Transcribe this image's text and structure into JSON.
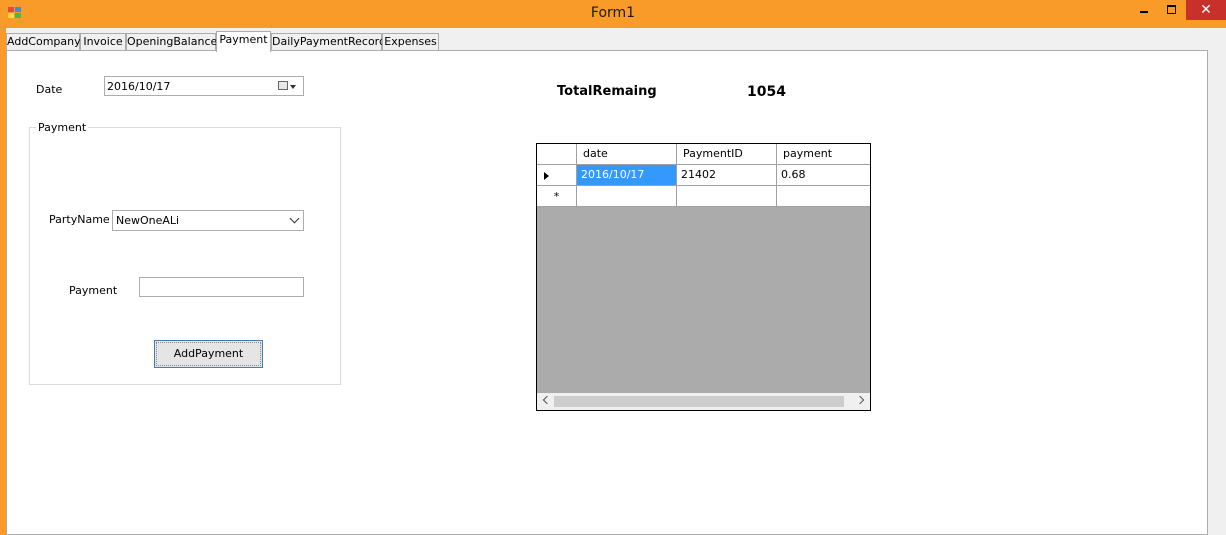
{
  "window": {
    "title": "Form1",
    "close_glyph": "✕"
  },
  "tabs": [
    {
      "label": "AddCompany"
    },
    {
      "label": "Invoice"
    },
    {
      "label": "OpeningBalance"
    },
    {
      "label": "Payment"
    },
    {
      "label": "DailyPaymentRecord"
    },
    {
      "label": "Expenses"
    }
  ],
  "active_tab": "Payment",
  "form": {
    "date_label": "Date",
    "date_value": "2016/10/17",
    "group_title": "Payment",
    "party_label": "PartyName",
    "party_value": "NewOneALi",
    "payment_label": "Payment",
    "payment_value": "",
    "add_button": "AddPayment"
  },
  "summary": {
    "label": "TotalRemaing",
    "value": "1054"
  },
  "grid": {
    "columns": [
      "date",
      "PaymentID",
      "payment"
    ],
    "rows": [
      {
        "date": "2016/10/17",
        "PaymentID": "21402",
        "payment": "0.68"
      }
    ],
    "new_row_marker": "*"
  },
  "colors": {
    "titlebar": "#f89b29",
    "selection": "#3399ff",
    "close": "#c7302b"
  }
}
